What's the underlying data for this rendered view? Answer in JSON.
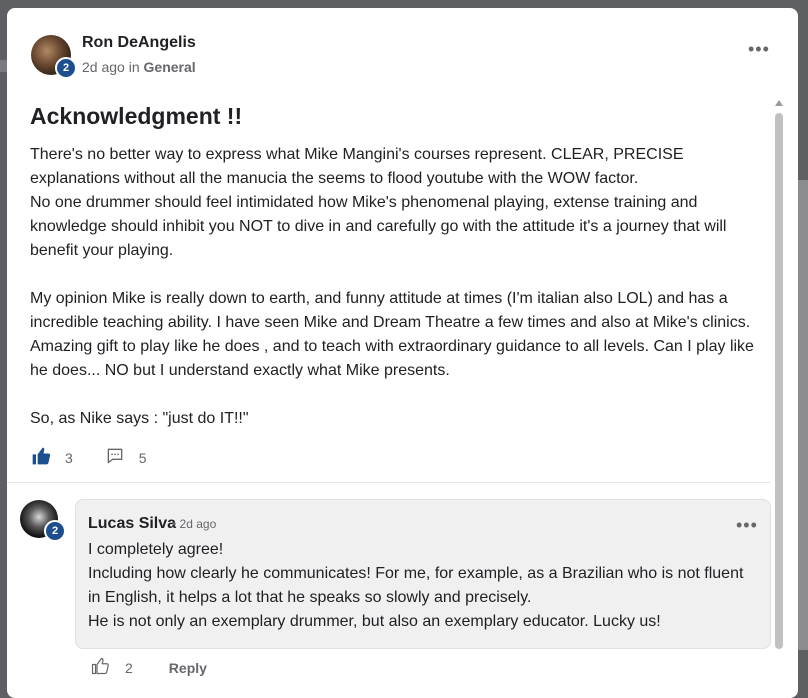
{
  "post": {
    "author": "Ron DeAngelis",
    "level": "2",
    "time": "2d ago",
    "in_label": "in",
    "category": "General",
    "title": "Acknowledgment !!",
    "paragraphs": [
      "There's no better way to express what Mike Mangini's courses represent. CLEAR, PRECISE explanations without all the manucia the seems to flood youtube with the WOW factor.\nNo one drummer should feel intimidated how Mike's phenomenal playing, extense training and knowledge should inhibit you NOT to dive in and carefully go with the attitude it's a journey that will benefit your playing.",
      "My opinion Mike is really down to earth, and funny attitude at times (I'm italian also LOL) and has a incredible teaching ability. I have seen Mike and Dream Theatre a few times and also at Mike's clinics. Amazing gift to play like he does , and to teach with extraordinary guidance to all levels. Can I play like he does... NO but I understand exactly what Mike presents.",
      "So, as Nike says : \"just do IT!!\""
    ],
    "likes": "3",
    "comments": "5"
  },
  "comment": {
    "author": "Lucas Silva",
    "level": "2",
    "time": "• 2d ago",
    "lines": [
      "I completely agree!",
      "Including how clearly he communicates! For me, for example, as a Brazilian who is not fluent in English, it helps a lot that he speaks so slowly and precisely.",
      "He is not only an exemplary drummer, but also an exemplary educator. Lucky us!"
    ],
    "likes": "2",
    "reply_label": "Reply"
  },
  "menu_glyph": "•••",
  "icons": {
    "post_like": "thumbs-up-filled-icon",
    "post_comment": "comment-bubble-icon",
    "comment_like": "thumbs-up-outline-icon",
    "more": "more-dots-icon"
  },
  "colors": {
    "accent": "#1d4f8f",
    "text": "#202124",
    "muted": "#65676b",
    "bubble": "#f0f0f1"
  }
}
